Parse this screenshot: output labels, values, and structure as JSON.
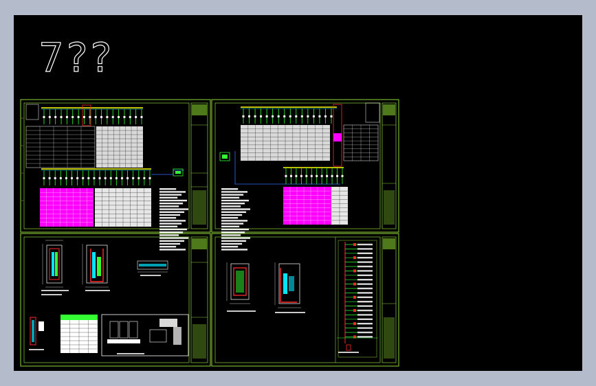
{
  "drawing": {
    "title_text": "7??",
    "colors": {
      "frame": "#8fd63d",
      "frame_dark": "#4f7a1c",
      "background": "#000000",
      "window_bg": "#b4bccb",
      "magenta": "#ff00ff",
      "cyan": "#00e5ff",
      "red": "#ff2a2a",
      "yellow": "#ffff00",
      "white": "#ffffff",
      "green": "#33ff33",
      "blue": "#3a6bff"
    }
  }
}
